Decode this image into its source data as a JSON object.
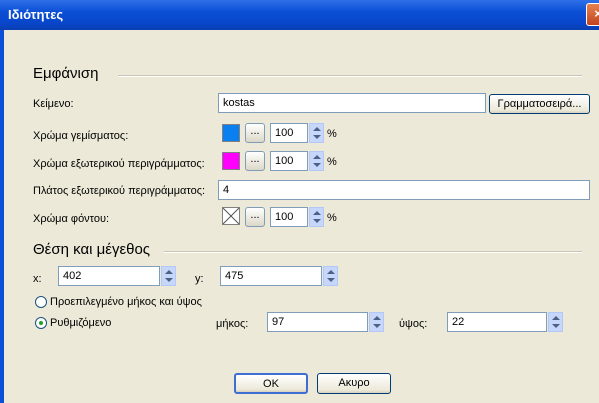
{
  "window": {
    "title": "Ιδιότητες",
    "close_glyph": "×"
  },
  "appearance": {
    "heading": "Εμφάνιση",
    "text_label": "Κείμενο:",
    "text_value": "kostas",
    "font_button": "Γραμματοσειρά...",
    "fill_label": "Χρώμα γεμίσματος:",
    "fill_color": "#0a7ff0",
    "fill_opacity": "100",
    "outline_label": "Χρώμα εξωτερικού περιγράμματος:",
    "outline_color": "#ff00ff",
    "outline_opacity": "100",
    "outline_width_label": "Πλάτος εξωτερικού περιγράμματος:",
    "outline_width_value": "4",
    "bg_label": "Χρώμα φόντου:",
    "bg_opacity": "100",
    "dots": "...",
    "percent": "%"
  },
  "position": {
    "heading": "Θέση και μέγεθος",
    "x_label": "x:",
    "x_value": "402",
    "y_label": "y:",
    "y_value": "475",
    "default_size_label": "Προεπιλεγμένο μήκος και ύψος",
    "custom_label": "Ρυθμιζόμενο",
    "selected": "custom",
    "length_label": "μήκος:",
    "length_value": "97",
    "height_label": "ύψος:",
    "height_value": "22"
  },
  "buttons": {
    "ok": "OK",
    "cancel": "Ακυρο"
  },
  "colors": {
    "title_blue": "#0a4fd6",
    "dialog_bg": "#ece9d8",
    "field_border": "#7f9db9"
  }
}
